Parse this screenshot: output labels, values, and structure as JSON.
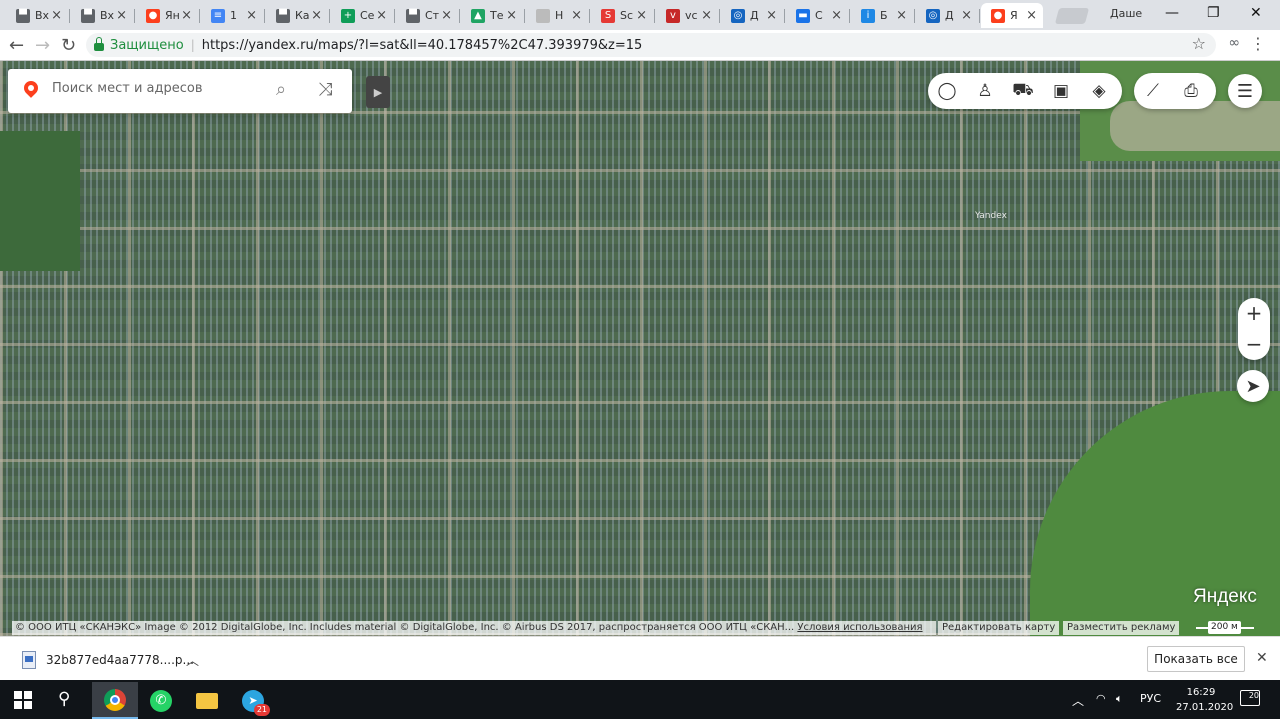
{
  "browser": {
    "tabs": [
      {
        "title": "Вх",
        "icon": "folder-icon",
        "color": "#5f6368"
      },
      {
        "title": "Вх",
        "icon": "folder-icon",
        "color": "#5f6368"
      },
      {
        "title": "Ян",
        "icon": "map-pin-icon",
        "color": "#fc3f1d"
      },
      {
        "title": "1",
        "icon": "docs-icon",
        "color": "#4285f4"
      },
      {
        "title": "Ка",
        "icon": "folder-icon",
        "color": "#5f6368"
      },
      {
        "title": "Се",
        "icon": "sheets-icon",
        "color": "#0f9d58"
      },
      {
        "title": "Ст",
        "icon": "folder-icon",
        "color": "#5f6368"
      },
      {
        "title": "Те",
        "icon": "drive-icon",
        "color": "#1fa463"
      },
      {
        "title": "Н",
        "icon": "blank-page-icon",
        "color": "#bbbbbb"
      },
      {
        "title": "Sc",
        "icon": "s-logo-icon",
        "color": "#e53935"
      },
      {
        "title": "vc",
        "icon": "vc-logo-icon",
        "color": "#c62828"
      },
      {
        "title": "Д",
        "icon": "target-icon",
        "color": "#1565c0"
      },
      {
        "title": "С",
        "icon": "chat-icon",
        "color": "#1a73e8"
      },
      {
        "title": "Б",
        "icon": "info-icon",
        "color": "#1e88e5"
      },
      {
        "title": "Д",
        "icon": "target-icon",
        "color": "#1565c0"
      },
      {
        "title": "Я",
        "icon": "map-pin-icon",
        "color": "#fc3f1d",
        "active": true
      }
    ],
    "profile_name": "Даше",
    "secure_label": "Защищено",
    "url": "https://yandex.ru/maps/?l=sat&ll=40.178457%2C47.393979&z=15"
  },
  "map": {
    "search_placeholder": "Поиск мест и адресов",
    "watermark": "Yandex",
    "logo": "Яндекс",
    "copyright": "© ООО ИТЦ «СКАНЭКС» Image © 2012 DigitalGlobe, Inc. Includes material © DigitalGlobe, Inc. © Airbus DS 2017, распространяется ООО ИТЦ «СКАН...",
    "terms": "Условия использования",
    "edit_map": "Редактировать карту",
    "place_ad": "Разместить рекламу",
    "scale": "200 м",
    "zoom_in": "+",
    "zoom_out": "−"
  },
  "downloads": {
    "file_name": "32b877ed4aa7778....p...",
    "show_all": "Показать все"
  },
  "taskbar": {
    "lang": "РУС",
    "time": "16:29",
    "date": "27.01.2020",
    "telegram_badge": "21",
    "notifications": "20"
  }
}
